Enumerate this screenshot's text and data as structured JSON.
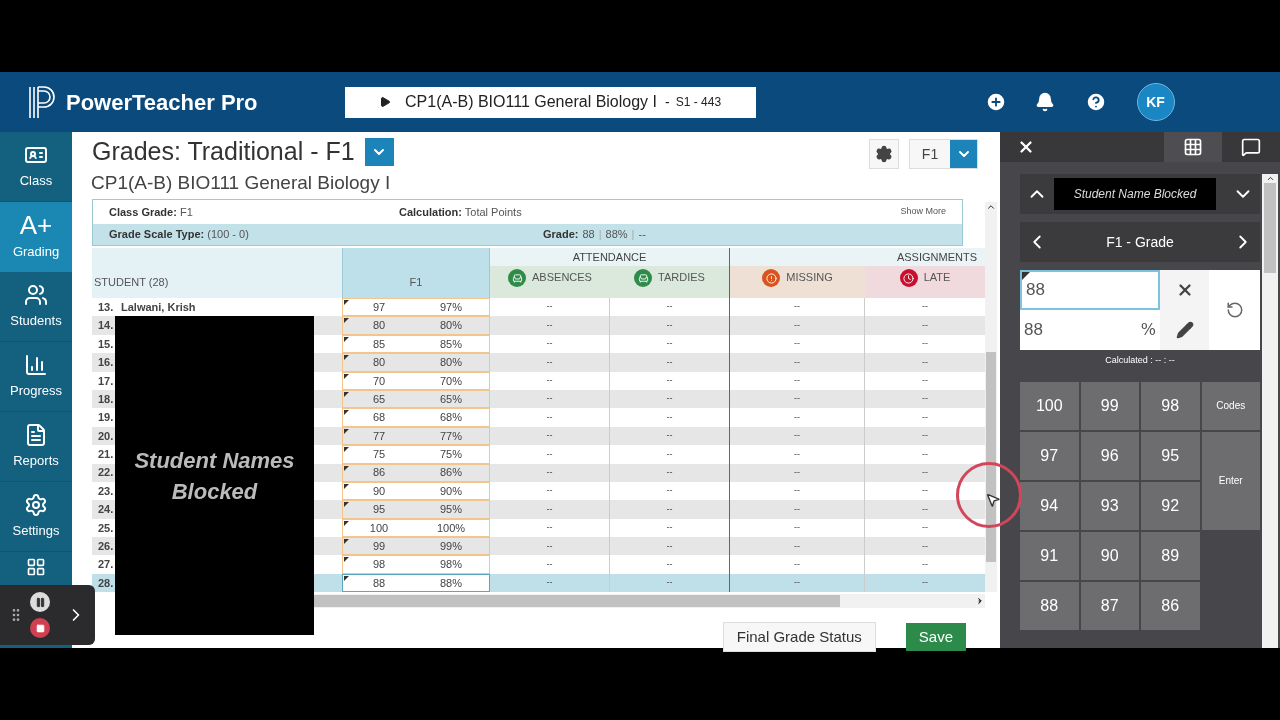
{
  "app": {
    "name": "PowerTeacher Pro",
    "class_selector": {
      "label": "CP1(A-B) BIO111 General Biology I",
      "separator": "-",
      "section": "S1 - 443"
    },
    "user": {
      "initials": "KF"
    }
  },
  "nav": [
    {
      "label": "Class",
      "kind": "class",
      "selected": false
    },
    {
      "label": "Grading",
      "kind": "grading",
      "icon_text": "A+",
      "selected": true
    },
    {
      "label": "Students",
      "kind": "students",
      "selected": false
    },
    {
      "label": "Progress",
      "kind": "progress",
      "selected": false
    },
    {
      "label": "Reports",
      "kind": "reports",
      "selected": false
    },
    {
      "label": "Settings",
      "kind": "settings",
      "selected": false
    },
    {
      "kind": "apps",
      "selected": false
    }
  ],
  "page": {
    "title": "Grades: Traditional - F1",
    "subtitle": "CP1(A-B) BIO111 General Biology I",
    "term": "F1"
  },
  "summary": {
    "class_grade_label": "Class Grade:",
    "class_grade": "F1",
    "calculation_label": "Calculation:",
    "calculation": "Total Points",
    "show_more": "Show More",
    "scale_label": "Grade Scale Type:",
    "scale": "(100 - 0)",
    "grade_label": "Grade:",
    "grade": "88",
    "separator": "|",
    "percent": "88%",
    "letter": "--"
  },
  "table": {
    "student_header": "STUDENT (28)",
    "score_header": "F1",
    "groups": [
      {
        "label": "ATTENDANCE"
      },
      {
        "label": "ASSIGNMENTS"
      }
    ],
    "columns": [
      {
        "label": "ABSENCES",
        "kind": "attendance"
      },
      {
        "label": "TARDIES",
        "kind": "attendance"
      },
      {
        "label": "MISSING",
        "kind": "missing"
      },
      {
        "label": "LATE",
        "kind": "late"
      }
    ],
    "rows": [
      {
        "number": "13.",
        "name": "Lalwani, Krish",
        "score": "97",
        "percent": "97%",
        "cells": [
          "--",
          "--",
          "--",
          "--"
        ],
        "selected": false
      },
      {
        "number": "14.",
        "score": "80",
        "percent": "80%",
        "cells": [
          "--",
          "--",
          "--",
          "--"
        ],
        "selected": false
      },
      {
        "number": "15.",
        "score": "85",
        "percent": "85%",
        "cells": [
          "--",
          "--",
          "--",
          "--"
        ],
        "selected": false
      },
      {
        "number": "16.",
        "score": "80",
        "percent": "80%",
        "cells": [
          "--",
          "--",
          "--",
          "--"
        ],
        "selected": false
      },
      {
        "number": "17.",
        "score": "70",
        "percent": "70%",
        "cells": [
          "--",
          "--",
          "--",
          "--"
        ],
        "selected": false
      },
      {
        "number": "18.",
        "score": "65",
        "percent": "65%",
        "cells": [
          "--",
          "--",
          "--",
          "--"
        ],
        "selected": false
      },
      {
        "number": "19.",
        "score": "68",
        "percent": "68%",
        "cells": [
          "--",
          "--",
          "--",
          "--"
        ],
        "selected": false
      },
      {
        "number": "20.",
        "score": "77",
        "percent": "77%",
        "cells": [
          "--",
          "--",
          "--",
          "--"
        ],
        "selected": false
      },
      {
        "number": "21.",
        "score": "75",
        "percent": "75%",
        "cells": [
          "--",
          "--",
          "--",
          "--"
        ],
        "selected": false
      },
      {
        "number": "22.",
        "score": "86",
        "percent": "86%",
        "cells": [
          "--",
          "--",
          "--",
          "--"
        ],
        "selected": false
      },
      {
        "number": "23.",
        "score": "90",
        "percent": "90%",
        "cells": [
          "--",
          "--",
          "--",
          "--"
        ],
        "selected": false
      },
      {
        "number": "24.",
        "score": "95",
        "percent": "95%",
        "cells": [
          "--",
          "--",
          "--",
          "--"
        ],
        "selected": false
      },
      {
        "number": "25.",
        "score": "100",
        "percent": "100%",
        "cells": [
          "--",
          "--",
          "--",
          "--"
        ],
        "selected": false
      },
      {
        "number": "26.",
        "score": "99",
        "percent": "99%",
        "cells": [
          "--",
          "--",
          "--",
          "--"
        ],
        "selected": false
      },
      {
        "number": "27.",
        "score": "98",
        "percent": "98%",
        "cells": [
          "--",
          "--",
          "--",
          "--"
        ],
        "selected": false
      },
      {
        "number": "28.",
        "score": "88",
        "percent": "88%",
        "cells": [
          "--",
          "--",
          "--",
          "--"
        ],
        "selected": true
      }
    ]
  },
  "overlay": {
    "text": "Student Names Blocked"
  },
  "footer": {
    "final_grade_status": "Final Grade Status",
    "save": "Save"
  },
  "panel": {
    "tabs": [
      {
        "kind": "grid",
        "selected": true
      },
      {
        "kind": "comment",
        "selected": false
      }
    ],
    "student": "Student Name Blocked",
    "assignment": "F1 - Grade",
    "entry": "88",
    "percent": "88",
    "percent_sign": "%",
    "calculated": "Calculated : -- : --",
    "keys": [
      "100",
      "99",
      "98",
      "97",
      "96",
      "95",
      "94",
      "93",
      "92",
      "91",
      "90",
      "89",
      "88",
      "87",
      "86"
    ],
    "codes": "Codes",
    "enter": "Enter"
  }
}
